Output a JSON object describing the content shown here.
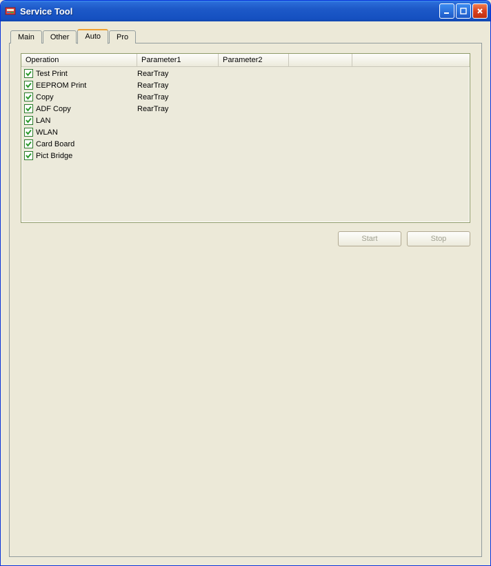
{
  "window": {
    "title": "Service Tool"
  },
  "tabs": [
    {
      "label": "Main",
      "active": false
    },
    {
      "label": "Other",
      "active": false
    },
    {
      "label": "Auto",
      "active": true
    },
    {
      "label": "Pro",
      "active": false
    }
  ],
  "listview": {
    "columns": [
      "Operation",
      "Parameter1",
      "Parameter2",
      "",
      ""
    ],
    "rows": [
      {
        "checked": true,
        "operation": "Test Print",
        "parameter1": "RearTray",
        "parameter2": ""
      },
      {
        "checked": true,
        "operation": "EEPROM Print",
        "parameter1": "RearTray",
        "parameter2": ""
      },
      {
        "checked": true,
        "operation": "Copy",
        "parameter1": "RearTray",
        "parameter2": ""
      },
      {
        "checked": true,
        "operation": "ADF Copy",
        "parameter1": "RearTray",
        "parameter2": ""
      },
      {
        "checked": true,
        "operation": "LAN",
        "parameter1": "",
        "parameter2": ""
      },
      {
        "checked": true,
        "operation": "WLAN",
        "parameter1": "",
        "parameter2": ""
      },
      {
        "checked": true,
        "operation": "Card Board",
        "parameter1": "",
        "parameter2": ""
      },
      {
        "checked": true,
        "operation": "Pict Bridge",
        "parameter1": "",
        "parameter2": ""
      }
    ]
  },
  "buttons": {
    "start": "Start",
    "stop": "Stop"
  }
}
